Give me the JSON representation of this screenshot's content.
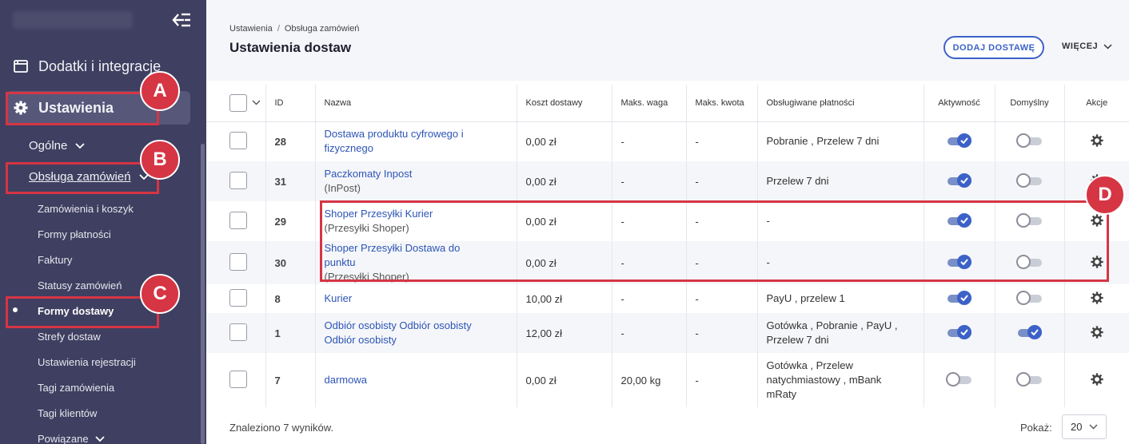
{
  "sidebar": {
    "addons_label": "Dodatki i integracje",
    "settings_label": "Ustawienia",
    "general_label": "Ogólne",
    "orders_label": "Obsługa zamówień",
    "sub_items": [
      {
        "label": "Zamówienia i koszyk"
      },
      {
        "label": "Formy płatności"
      },
      {
        "label": "Faktury"
      },
      {
        "label": "Statusy zamówień"
      },
      {
        "label": "Formy dostawy",
        "active": true
      },
      {
        "label": "Strefy dostaw"
      },
      {
        "label": "Ustawienia rejestracji"
      },
      {
        "label": "Tagi zamówienia"
      },
      {
        "label": "Tagi klientów"
      },
      {
        "label": "Powiązane"
      }
    ]
  },
  "annotations": [
    "A",
    "B",
    "C",
    "D"
  ],
  "header": {
    "breadcrumb": [
      "Ustawienia",
      "Obsługa zamówień"
    ],
    "breadcrumb_sep": "/",
    "title": "Ustawienia dostaw",
    "add_button": "DODAJ DOSTAWĘ",
    "more_button": "WIĘCEJ"
  },
  "table": {
    "columns": [
      "ID",
      "Nazwa",
      "Koszt dostawy",
      "Maks. waga",
      "Maks. kwota",
      "Obsługiwane płatności",
      "Aktywność",
      "Domyślny",
      "Akcje"
    ],
    "rows": [
      {
        "id": "28",
        "name": "Dostawa produktu cyfrowego i fizycznego",
        "sub": "",
        "cost": "0,00 zł",
        "weight": "-",
        "amount": "-",
        "payments": "Pobranie , Przelew 7 dni",
        "active": true,
        "default": false
      },
      {
        "id": "31",
        "name": "Paczkomaty Inpost",
        "sub": "(InPost)",
        "cost": "0,00 zł",
        "weight": "-",
        "amount": "-",
        "payments": "Przelew 7 dni",
        "active": true,
        "default": false
      },
      {
        "id": "29",
        "name": "Shoper Przesyłki Kurier",
        "sub": "(Przesyłki Shoper)",
        "cost": "0,00 zł",
        "weight": "-",
        "amount": "-",
        "payments": "-",
        "active": true,
        "default": false
      },
      {
        "id": "30",
        "name": "Shoper Przesyłki Dostawa do punktu",
        "sub": "(Przesyłki Shoper)",
        "cost": "0,00 zł",
        "weight": "-",
        "amount": "-",
        "payments": "-",
        "active": true,
        "default": false
      },
      {
        "id": "8",
        "name": "Kurier",
        "sub": "",
        "cost": "10,00 zł",
        "weight": "-",
        "amount": "-",
        "payments": "PayU , przelew 1",
        "active": true,
        "default": false
      },
      {
        "id": "1",
        "name": "Odbiór osobisty Odbiór osobisty Odbiór osobisty",
        "sub": "",
        "cost": "12,00 zł",
        "weight": "-",
        "amount": "-",
        "payments": "Gotówka , Pobranie , PayU , Przelew 7 dni",
        "active": true,
        "default": true
      },
      {
        "id": "7",
        "name": "darmowa",
        "sub": "",
        "cost": "0,00 zł",
        "weight": "20,00 kg",
        "amount": "-",
        "payments": "Gotówka , Przelew natychmiastowy , mBank mRaty",
        "active": false,
        "default": false
      }
    ]
  },
  "footer": {
    "results": "Znaleziono 7 wyników.",
    "show_label": "Pokaż:",
    "per_page": "20"
  },
  "colors": {
    "sidebar": "#3f3f61",
    "accent": "#3c62c8",
    "annotation": "#d63544"
  }
}
